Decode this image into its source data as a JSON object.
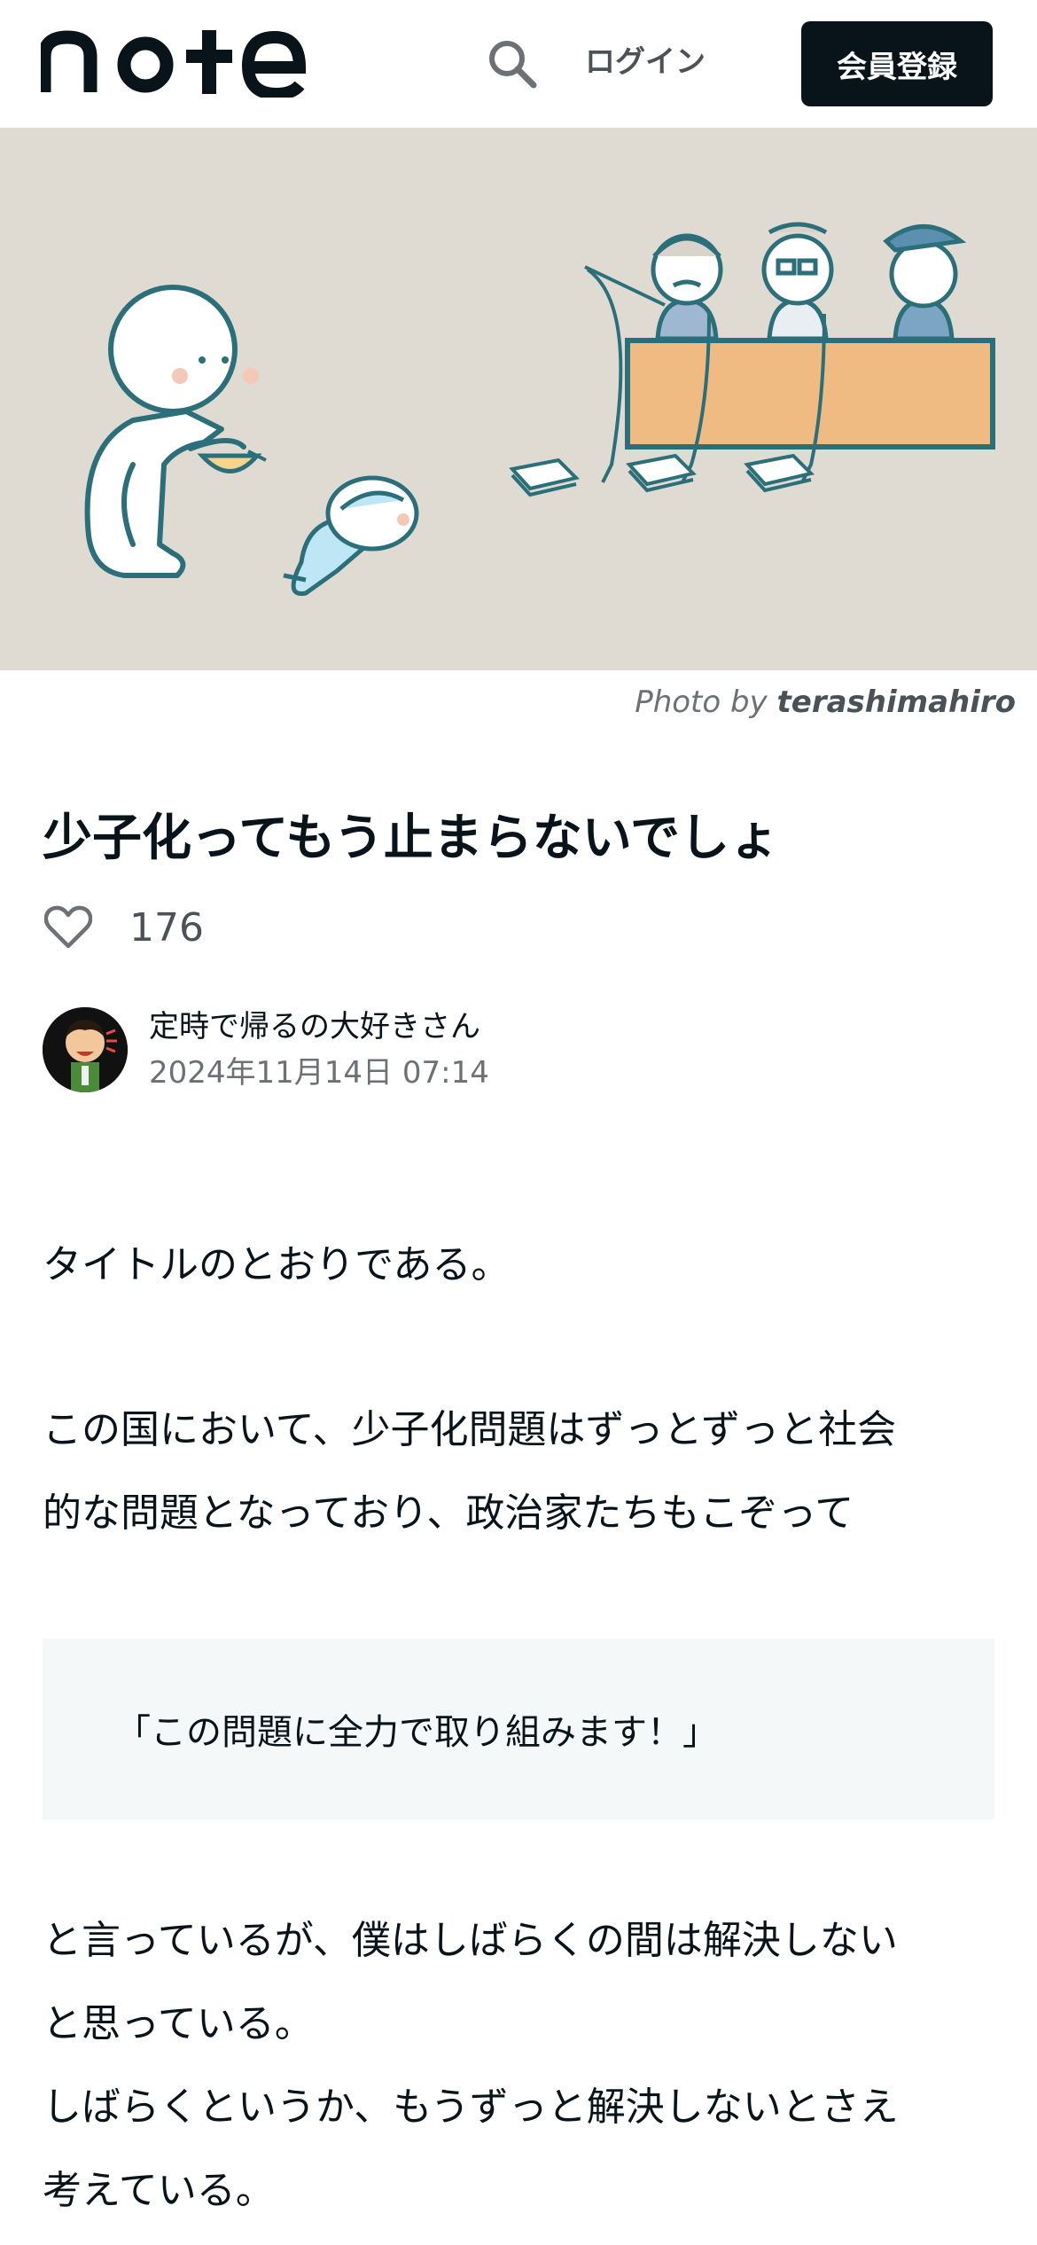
{
  "header": {
    "logo_text": "note",
    "search_icon": "search-icon",
    "login_label": "ログイン",
    "register_label": "会員登録"
  },
  "hero": {
    "image_description_icon": "illustration",
    "photo_credit_prefix": "Photo by ",
    "photo_credit_author": "terashimahiro"
  },
  "article": {
    "title": "少子化ってもう止まらないでしょ",
    "like_icon": "heart-outline-icon",
    "like_count": "176",
    "author_name": "定時で帰るの大好きさん",
    "post_date": "2024年11月14日 07:14",
    "paragraph_1": "タイトルのとおりである。",
    "paragraph_2_line_1": "この国において、少子化問題はずっとずっと社会",
    "paragraph_2_line_2": "的な問題となっており、政治家たちもこぞって",
    "quote": "「この問題に全力で取り組みます！」",
    "paragraph_3_line_1": "と言っているが、僕はしばらくの間は解決しない",
    "paragraph_3_line_2": "と思っている。",
    "paragraph_3_line_3": "しばらくというか、もうずっと解決しないとさえ",
    "paragraph_3_line_4": "考えている。"
  },
  "colors": {
    "text_primary": "#08131a",
    "text_secondary": "#6b7175",
    "button_dark": "#08131a",
    "hero_bg": "#dfdbd2",
    "quote_bg": "#f5f8f8",
    "desk_orange": "#f0bb83",
    "outline_teal": "#2b6f7a"
  }
}
